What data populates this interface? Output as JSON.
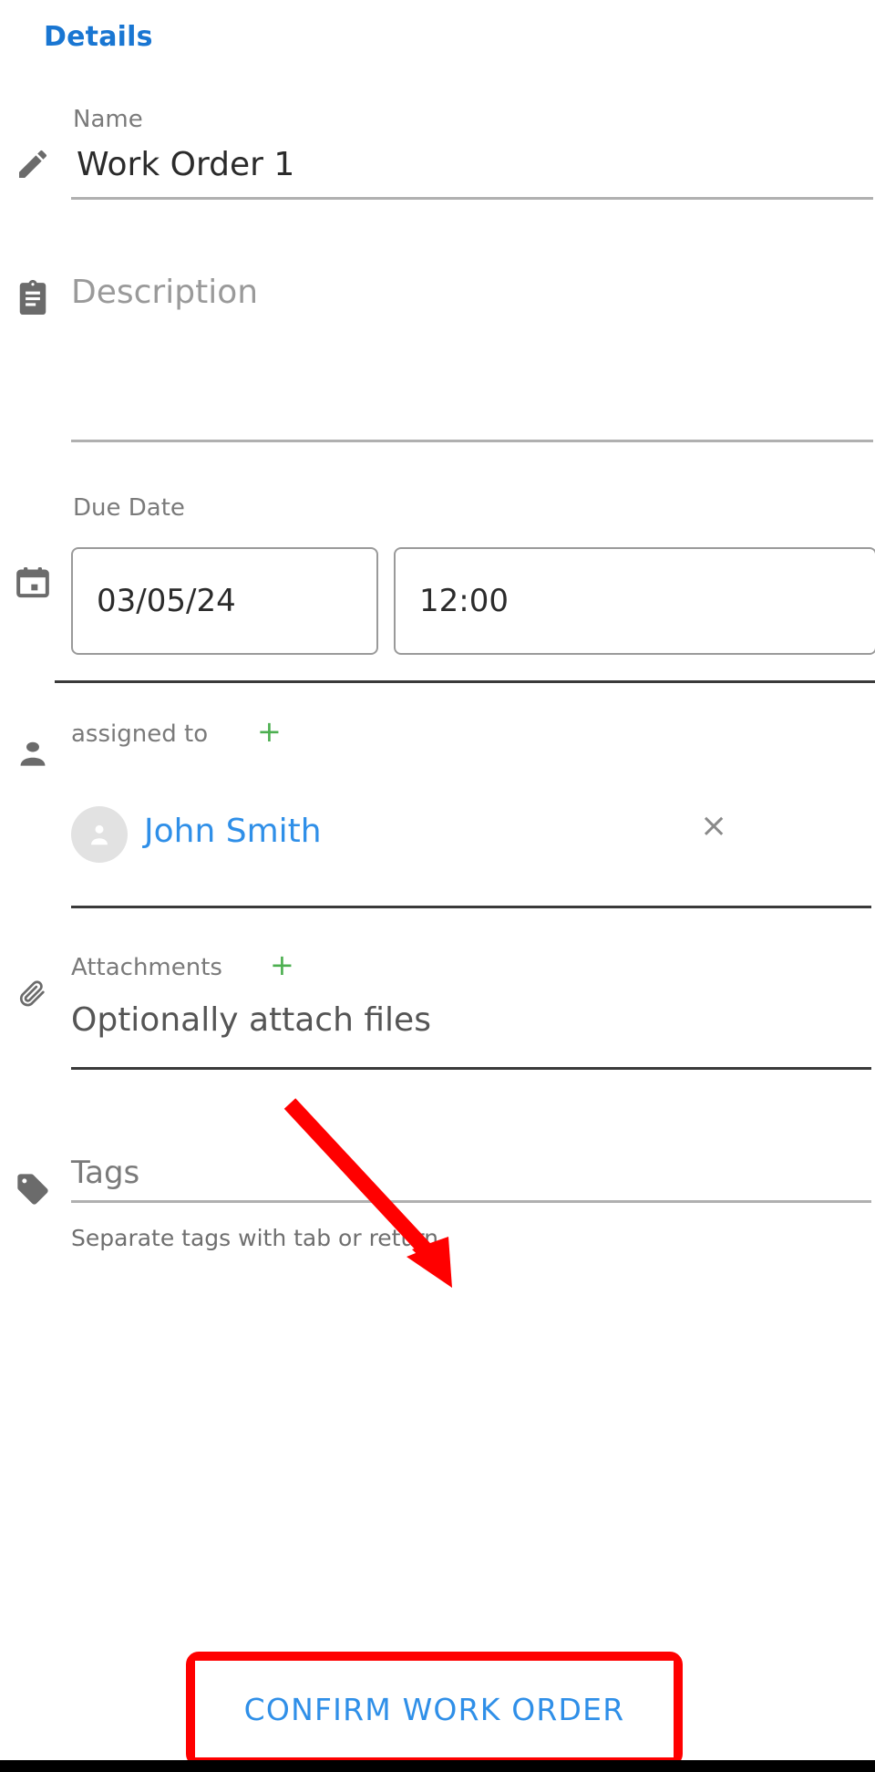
{
  "panel": {
    "title": "Details"
  },
  "fields": {
    "name": {
      "label": "Name",
      "value": "Work Order 1",
      "icon": "pencil-icon"
    },
    "description": {
      "placeholder": "Description",
      "value": "",
      "icon": "clipboard-icon"
    },
    "due_date": {
      "label": "Due Date",
      "date_value": "03/05/24",
      "time_value": "12:00",
      "icon": "calendar-icon"
    },
    "assigned_to": {
      "label": "assigned to",
      "add_label": "+",
      "icon": "person-icon",
      "assignees": [
        {
          "name": "John Smith",
          "remove_label": "×"
        }
      ]
    },
    "attachments": {
      "label": "Attachments",
      "add_label": "+",
      "placeholder": "Optionally attach files",
      "icon": "paperclip-icon"
    },
    "tags": {
      "label": "Tags",
      "value": "",
      "hint": "Separate tags with tab or return.",
      "icon": "tag-icon"
    }
  },
  "actions": {
    "confirm_label": "CONFIRM WORK ORDER"
  },
  "annotation": {
    "arrow_color": "#ff0000",
    "highlight_color": "#ff0000"
  },
  "colors": {
    "accent": "#1976d2",
    "link": "#2f8fe8",
    "add": "#4caf50",
    "muted": "#7a7a7a"
  }
}
